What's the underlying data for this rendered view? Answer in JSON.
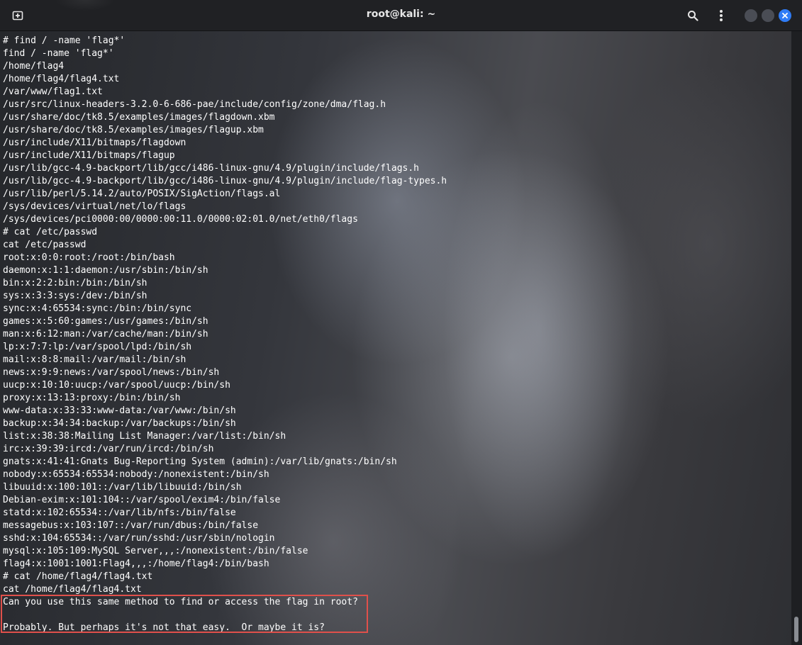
{
  "window": {
    "title": "root@kali: ~",
    "accent_color": "#2f7cf6",
    "highlight_color": "#e0504b"
  },
  "toolbar": {
    "new_tab_icon": "new-tab-icon",
    "search_icon": "search-icon",
    "menu_icon": "kebab-menu-icon",
    "minimize_icon": "minimize-icon",
    "maximize_icon": "maximize-icon",
    "close_icon": "close-icon"
  },
  "terminal": {
    "lines": [
      "# find / -name 'flag*'",
      "find / -name 'flag*'",
      "/home/flag4",
      "/home/flag4/flag4.txt",
      "/var/www/flag1.txt",
      "/usr/src/linux-headers-3.2.0-6-686-pae/include/config/zone/dma/flag.h",
      "/usr/share/doc/tk8.5/examples/images/flagdown.xbm",
      "/usr/share/doc/tk8.5/examples/images/flagup.xbm",
      "/usr/include/X11/bitmaps/flagdown",
      "/usr/include/X11/bitmaps/flagup",
      "/usr/lib/gcc-4.9-backport/lib/gcc/i486-linux-gnu/4.9/plugin/include/flags.h",
      "/usr/lib/gcc-4.9-backport/lib/gcc/i486-linux-gnu/4.9/plugin/include/flag-types.h",
      "/usr/lib/perl/5.14.2/auto/POSIX/SigAction/flags.al",
      "/sys/devices/virtual/net/lo/flags",
      "/sys/devices/pci0000:00/0000:00:11.0/0000:02:01.0/net/eth0/flags",
      "# cat /etc/passwd",
      "cat /etc/passwd",
      "root:x:0:0:root:/root:/bin/bash",
      "daemon:x:1:1:daemon:/usr/sbin:/bin/sh",
      "bin:x:2:2:bin:/bin:/bin/sh",
      "sys:x:3:3:sys:/dev:/bin/sh",
      "sync:x:4:65534:sync:/bin:/bin/sync",
      "games:x:5:60:games:/usr/games:/bin/sh",
      "man:x:6:12:man:/var/cache/man:/bin/sh",
      "lp:x:7:7:lp:/var/spool/lpd:/bin/sh",
      "mail:x:8:8:mail:/var/mail:/bin/sh",
      "news:x:9:9:news:/var/spool/news:/bin/sh",
      "uucp:x:10:10:uucp:/var/spool/uucp:/bin/sh",
      "proxy:x:13:13:proxy:/bin:/bin/sh",
      "www-data:x:33:33:www-data:/var/www:/bin/sh",
      "backup:x:34:34:backup:/var/backups:/bin/sh",
      "list:x:38:38:Mailing List Manager:/var/list:/bin/sh",
      "irc:x:39:39:ircd:/var/run/ircd:/bin/sh",
      "gnats:x:41:41:Gnats Bug-Reporting System (admin):/var/lib/gnats:/bin/sh",
      "nobody:x:65534:65534:nobody:/nonexistent:/bin/sh",
      "libuuid:x:100:101::/var/lib/libuuid:/bin/sh",
      "Debian-exim:x:101:104::/var/spool/exim4:/bin/false",
      "statd:x:102:65534::/var/lib/nfs:/bin/false",
      "messagebus:x:103:107::/var/run/dbus:/bin/false",
      "sshd:x:104:65534::/var/run/sshd:/usr/sbin/nologin",
      "mysql:x:105:109:MySQL Server,,,:/nonexistent:/bin/false",
      "flag4:x:1001:1001:Flag4,,,:/home/flag4:/bin/bash",
      "# cat /home/flag4/flag4.txt",
      "cat /home/flag4/flag4.txt",
      "Can you use this same method to find or access the flag in root?",
      "",
      "Probably. But perhaps it's not that easy.  Or maybe it is?",
      "",
      "#"
    ]
  }
}
